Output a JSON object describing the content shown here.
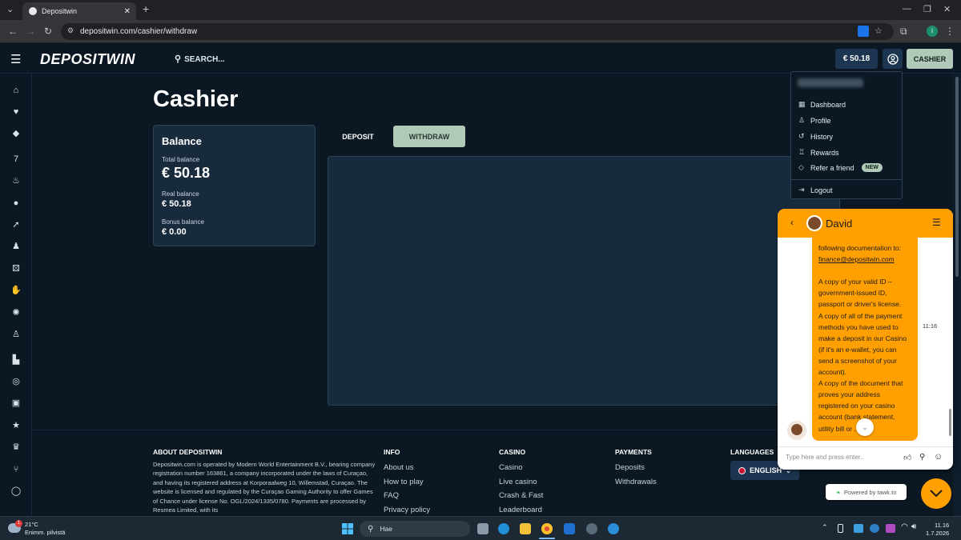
{
  "browser": {
    "tab_title": "Depositwin",
    "new_tab": "+",
    "url": "depositwin.com/cashier/withdraw"
  },
  "header": {
    "logo": "DEPOSITWIN",
    "search": "SEARCH...",
    "balance": "€ 50.18",
    "cashier": "CASHIER"
  },
  "page": {
    "title": "Cashier"
  },
  "balance_card": {
    "heading": "Balance",
    "total_label": "Total balance",
    "total_value": "€ 50.18",
    "real_label": "Real balance",
    "real_value": "€ 50.18",
    "bonus_label": "Bonus balance",
    "bonus_value": "€ 0.00"
  },
  "tabs": {
    "deposit": "DEPOSIT",
    "withdraw": "WITHDRAW"
  },
  "user_menu": {
    "items": [
      {
        "label": "Dashboard",
        "icon": "grid-icon"
      },
      {
        "label": "Profile",
        "icon": "user-icon"
      },
      {
        "label": "History",
        "icon": "history-icon"
      },
      {
        "label": "Rewards",
        "icon": "rewards-icon"
      },
      {
        "label": "Refer a friend",
        "icon": "diamond-icon"
      },
      {
        "label": "Logout",
        "icon": "logout-icon"
      }
    ],
    "new_badge": "NEW"
  },
  "footer": {
    "about_heading": "ABOUT DEPOSITWIN",
    "about_text": "Depositwin.com is operated by Modern World Entertainment B.V., bearing company registration number 163861, a company incorporated under the laws of Curaçao, and having its registered address at Korporaalweg 10, Willemstad, Curaçao. The website is licensed and regulated by the Curaçao Gaming Authority to offer Games of Chance under license No. OGL/2024/1335/0780. Payments are processed by Resmea Limited, with its",
    "info_heading": "INFO",
    "info_links": [
      "About us",
      "How to play",
      "FAQ",
      "Privacy policy"
    ],
    "casino_heading": "CASINO",
    "casino_links": [
      "Casino",
      "Live casino",
      "Crash & Fast",
      "Leaderboard"
    ],
    "payments_heading": "PAYMENTS",
    "payments_links": [
      "Deposits",
      "Withdrawals"
    ],
    "languages_heading": "LANGUAGES",
    "language": "ENGLISH"
  },
  "chat": {
    "agent_name": "David",
    "message_lines": [
      "following documentation to:",
      "finance@depositwin.com",
      "",
      "A copy of your valid ID –",
      "government-issued ID,",
      "passport or driver's license.",
      "A copy of all of the payment",
      "methods you have used to",
      "make a deposit in our Casino",
      "(if it's an e-wallet, you can",
      "send a screenshot of your",
      "account).",
      "A copy of the document that",
      "proves your address",
      "registered on your casino",
      "account (bank statement,",
      "utility bill or ..."
    ],
    "time": "11:16",
    "input_placeholder": "Type here and press enter..",
    "powered_by": "Powered by tawk.to"
  },
  "taskbar": {
    "temperature": "21°C",
    "weather_desc": "Enimm. pilvistä",
    "weather_badge": "1",
    "search": "Hae",
    "time": "11.16",
    "date": "1.7.2026"
  },
  "colors": {
    "background": "#0b1722",
    "card": "#182b3d",
    "accent_green": "#b1c9b8",
    "chat_orange": "#ff9f00"
  }
}
